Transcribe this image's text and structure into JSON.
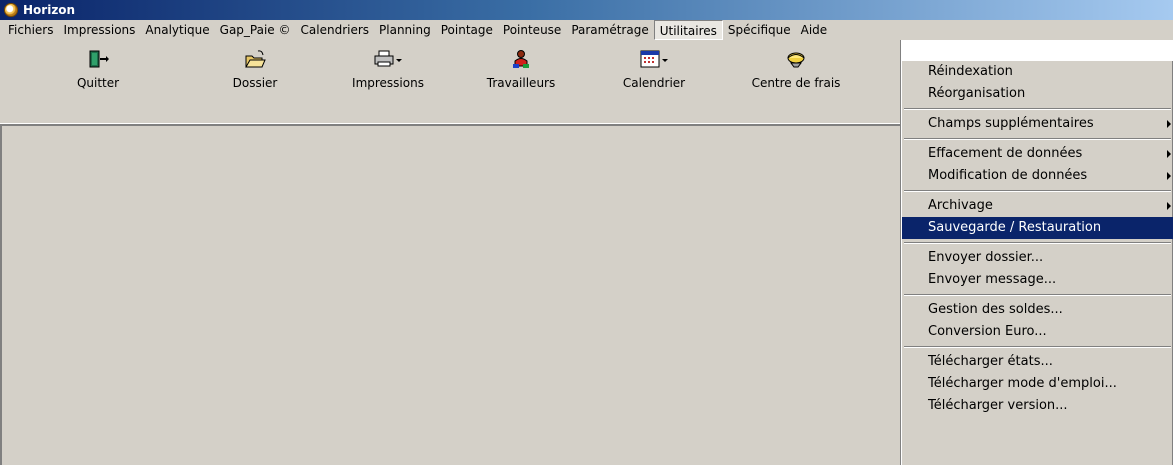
{
  "window": {
    "title": "Horizon"
  },
  "menubar": [
    {
      "label": "Fichiers"
    },
    {
      "label": "Impressions"
    },
    {
      "label": "Analytique"
    },
    {
      "label": "Gap_Paie ©"
    },
    {
      "label": "Calendriers"
    },
    {
      "label": "Planning"
    },
    {
      "label": "Pointage"
    },
    {
      "label": "Pointeuse"
    },
    {
      "label": "Paramétrage"
    },
    {
      "label": "Utilitaires"
    },
    {
      "label": "Spécifique"
    },
    {
      "label": "Aide"
    }
  ],
  "toolbar": [
    {
      "label": "Quitter",
      "icon": "exit-door-icon"
    },
    {
      "label": "Dossier",
      "icon": "open-folder-icon"
    },
    {
      "label": "Impressions",
      "icon": "printer-icon"
    },
    {
      "label": "Travailleurs",
      "icon": "workers-icon"
    },
    {
      "label": "Calendrier",
      "icon": "calendar-icon"
    },
    {
      "label": "Centre de frais",
      "icon": "cost-center-icon"
    }
  ],
  "utilitaires_menu": {
    "groups": [
      [
        {
          "label": "Réindexation"
        },
        {
          "label": "Réorganisation"
        }
      ],
      [
        {
          "label": "Champs supplémentaires",
          "submenu": true
        }
      ],
      [
        {
          "label": "Effacement de données",
          "submenu": true
        },
        {
          "label": "Modification de données",
          "submenu": true
        }
      ],
      [
        {
          "label": "Archivage",
          "submenu": true
        },
        {
          "label": "Sauvegarde / Restauration",
          "selected": true
        }
      ],
      [
        {
          "label": "Envoyer dossier..."
        },
        {
          "label": "Envoyer message..."
        }
      ],
      [
        {
          "label": "Gestion des soldes..."
        },
        {
          "label": "Conversion Euro..."
        }
      ],
      [
        {
          "label": "Télécharger états..."
        },
        {
          "label": "Télécharger mode d'emploi..."
        },
        {
          "label": "Télécharger version..."
        }
      ]
    ]
  },
  "colors": {
    "face": "#d4d0c8",
    "highlight": "#0a246a",
    "title_start": "#0a246a",
    "title_end": "#a6caf0"
  }
}
